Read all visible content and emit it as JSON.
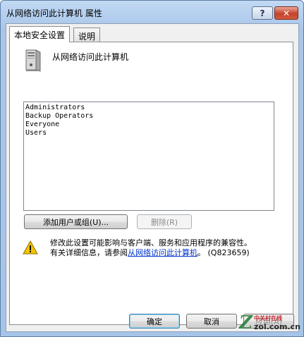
{
  "window": {
    "title": "从网络访问此计算机 属性",
    "help_label": "?",
    "close_label": "✕"
  },
  "tabs": [
    {
      "label": "本地安全设置",
      "active": true
    },
    {
      "label": "说明",
      "active": false
    }
  ],
  "policy": {
    "name": "从网络访问此计算机",
    "icon": "computer-icon"
  },
  "list": {
    "items": [
      "Administrators",
      "Backup Operators",
      "Everyone",
      "Users"
    ]
  },
  "buttons": {
    "add": "添加用户或组(U)...",
    "remove": "删除(R)",
    "ok": "确定",
    "cancel": "取消",
    "apply": "应用(A)"
  },
  "warning": {
    "icon": "warning-icon",
    "line1": "修改此设置可能影响与客户端、服务和应用程序的兼容性。",
    "line2_prefix": "有关详细信息，请参阅",
    "link": "从网络访问此计算机",
    "line2_suffix": "。 (Q823659)"
  },
  "watermark": {
    "top": "中关村在线",
    "bottom": "zol.com.cn"
  },
  "colors": {
    "link": "#0033cc",
    "close_button": "#c5432a",
    "warning_fill": "#f5c400"
  }
}
